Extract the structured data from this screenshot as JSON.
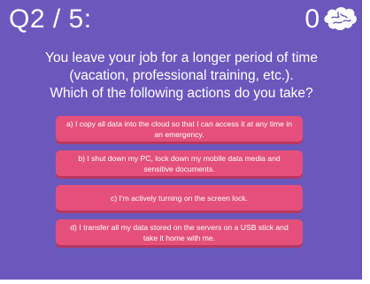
{
  "header": {
    "counter": "Q2 / 5:",
    "score": "0"
  },
  "question": {
    "lines": [
      "You leave your job for a longer period of time",
      "(vacation, professional training, etc.).",
      "Which of the following actions do you take?"
    ]
  },
  "answers": [
    {
      "label": "a) I copy all data into the cloud so that I can access it at any time in an emergency."
    },
    {
      "label": "b) I shut down my PC, lock down my mobile data media and sensitive documents."
    },
    {
      "label": "c) I'm actively turning on the screen lock."
    },
    {
      "label": "d) I transfer all my data stored on the servers on a USB stick and take it home with me."
    }
  ],
  "colors": {
    "background": "#6b58bd",
    "answer": "#e4507b",
    "answer_shadow": "#b83760",
    "text": "#ffffff"
  },
  "icons": {
    "score_icon": "brain-icon"
  }
}
